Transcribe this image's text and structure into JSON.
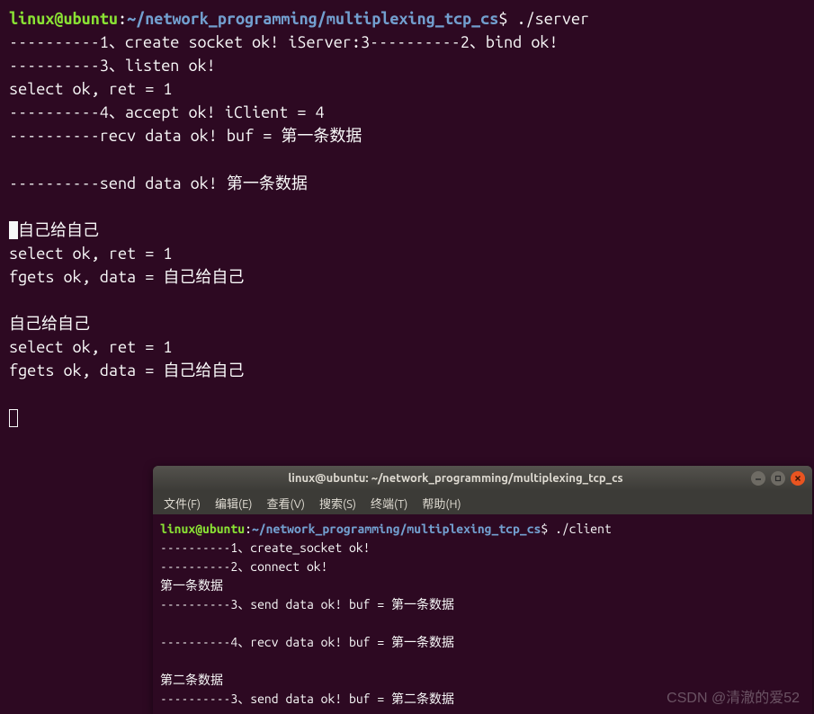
{
  "main_terminal": {
    "prompt": {
      "user_host": "linux@ubuntu",
      "colon": ":",
      "path": "~/network_programming/multiplexing_tcp_cs",
      "dollar": "$ ",
      "command": "./server"
    },
    "lines": [
      "----------1、create socket ok! iServer:3----------2、bind ok!",
      "----------3、listen ok!",
      "select ok, ret = 1",
      "----------4、accept ok! iClient = 4",
      "----------recv data ok! buf = 第一条数据",
      "",
      "----------send data ok! 第一条数据",
      ""
    ],
    "cursor_line": "自己给自己",
    "lines2": [
      "select ok, ret = 1",
      "fgets ok, data = 自己给自己",
      "",
      "自己给自己",
      "select ok, ret = 1",
      "fgets ok, data = 自己给自己",
      ""
    ]
  },
  "sub_window": {
    "title": "linux@ubuntu: ~/network_programming/multiplexing_tcp_cs",
    "menu": {
      "file": "文件(F)",
      "edit": "编辑(E)",
      "view": "查看(V)",
      "search": "搜索(S)",
      "terminal": "终端(T)",
      "help": "帮助(H)"
    },
    "prompt": {
      "user_host": "linux@ubuntu",
      "colon": ":",
      "path": "~/network_programming/multiplexing_tcp_cs",
      "dollar": "$ ",
      "command": "./client"
    },
    "lines": [
      "----------1、create_socket ok!",
      "----------2、connect ok!",
      "第一条数据",
      "----------3、send data ok! buf = 第一条数据",
      "",
      "----------4、recv data ok! buf = 第一条数据",
      "",
      "第二条数据",
      "----------3、send data ok! buf = 第二条数据"
    ]
  },
  "watermark": "CSDN @清澈的爱52"
}
